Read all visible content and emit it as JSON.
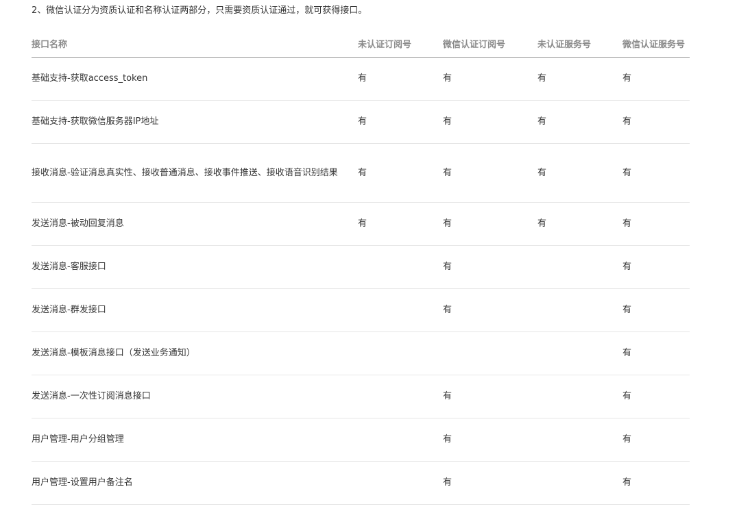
{
  "intro_text": "2、微信认证分为资质认证和名称认证两部分，只需要资质认证通过，就可获得接口。",
  "table": {
    "headers": [
      "接口名称",
      "未认证订阅号",
      "微信认证订阅号",
      "未认证服务号",
      "微信认证服务号"
    ],
    "rows": [
      {
        "name": "基础支持-获取access_token",
        "cells": [
          "有",
          "有",
          "有",
          "有"
        ]
      },
      {
        "name": "基础支持-获取微信服务器IP地址",
        "cells": [
          "有",
          "有",
          "有",
          "有"
        ]
      },
      {
        "name": "接收消息-验证消息真实性、接收普通消息、接收事件推送、接收语音识别结果",
        "cells": [
          "有",
          "有",
          "有",
          "有"
        ]
      },
      {
        "name": "发送消息-被动回复消息",
        "cells": [
          "有",
          "有",
          "有",
          "有"
        ]
      },
      {
        "name": "发送消息-客服接口",
        "cells": [
          "",
          "有",
          "",
          "有"
        ]
      },
      {
        "name": "发送消息-群发接口",
        "cells": [
          "",
          "有",
          "",
          "有"
        ]
      },
      {
        "name": "发送消息-模板消息接口（发送业务通知）",
        "cells": [
          "",
          "",
          "",
          "有"
        ]
      },
      {
        "name": "发送消息-一次性订阅消息接口",
        "cells": [
          "",
          "有",
          "",
          "有"
        ]
      },
      {
        "name": "用户管理-用户分组管理",
        "cells": [
          "",
          "有",
          "",
          "有"
        ]
      },
      {
        "name": "用户管理-设置用户备注名",
        "cells": [
          "",
          "有",
          "",
          "有"
        ]
      }
    ]
  }
}
